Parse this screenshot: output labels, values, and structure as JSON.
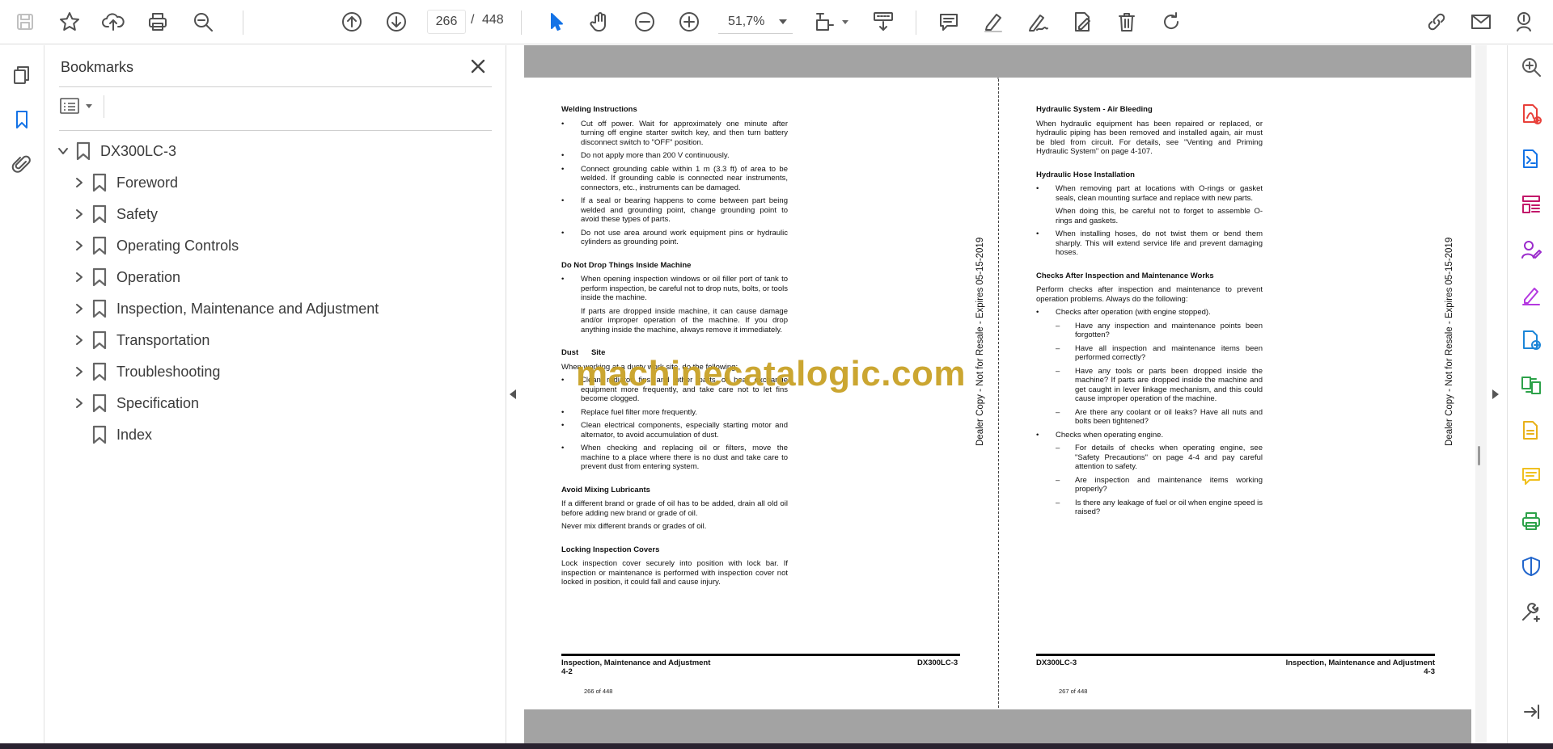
{
  "toolbar": {
    "current_page": "266",
    "page_separator": "/",
    "total_pages": "448",
    "zoom": "51,7%"
  },
  "bookmarks_panel": {
    "title": "Bookmarks",
    "root": "DX300LC-3",
    "items": [
      {
        "label": "Foreword",
        "expandable": true
      },
      {
        "label": "Safety",
        "expandable": true
      },
      {
        "label": "Operating Controls",
        "expandable": true
      },
      {
        "label": "Operation",
        "expandable": true
      },
      {
        "label": "Inspection, Maintenance and Adjustment",
        "expandable": true
      },
      {
        "label": "Transportation",
        "expandable": true
      },
      {
        "label": "Troubleshooting",
        "expandable": true
      },
      {
        "label": "Specification",
        "expandable": true
      },
      {
        "label": "Index",
        "expandable": false
      }
    ]
  },
  "watermark": "machinecatalogic.com",
  "left_page": {
    "side_stamp": "Dealer Copy - Not for Resale - Expires 05-15-2019",
    "welding": {
      "heading": "Welding Instructions",
      "bullets": [
        "Cut off power. Wait for approximately one minute after turning off engine starter switch key, and then turn battery disconnect switch to \"OFF\" position.",
        "Do not apply more than 200 V continuously.",
        "Connect grounding cable within 1 m (3.3 ft) of area to be welded. If grounding cable is connected near instruments, connectors, etc., instruments can be damaged.",
        "If a seal or bearing happens to come between part being welded and grounding point, change grounding point to avoid these types of parts.",
        "Do not use area around work equipment pins or hydraulic cylinders as grounding point."
      ]
    },
    "dropping": {
      "heading": "Do Not Drop Things Inside Machine",
      "bullet": "When opening inspection windows or oil filler port of tank to perform inspection, be careful not to drop nuts, bolts, or tools inside the machine.",
      "sub": "If parts are dropped inside machine, it can cause damage and/or improper operation of the machine. If you drop anything inside the machine, always remove it immediately."
    },
    "dusty": {
      "heading": "Dust      Site",
      "intro": "When working at a dusty work site, do the following:",
      "bullets": [
        "Clean radiator fins and other parts of heat exchange equipment more frequently, and take care not to let fins become clogged.",
        "Replace fuel filter more frequently.",
        "Clean electrical components, especially starting motor and alternator, to avoid accumulation of dust.",
        "When checking and replacing oil or filters, move the machine to a place where there is no dust and take care to prevent dust from entering system."
      ]
    },
    "lubricants": {
      "heading": "Avoid Mixing Lubricants",
      "p1": "If a different brand or grade of oil has to be added, drain all old oil before adding new brand or grade of oil.",
      "p2": "Never mix different brands or grades of oil."
    },
    "covers": {
      "heading": "Locking Inspection Covers",
      "p1": "Lock inspection cover securely into position with lock bar. If inspection or maintenance is performed with inspection cover not locked in position, it could fall and cause injury."
    },
    "footer_left": "Inspection, Maintenance and Adjustment",
    "footer_left_num": "4-2",
    "footer_right": "DX300LC-3",
    "page_counter": "266 of 448"
  },
  "right_page": {
    "side_stamp": "Dealer Copy - Not for Resale - Expires 05-15-2019",
    "bleeding": {
      "heading": "Hydraulic System - Air Bleeding",
      "p1": "When hydraulic equipment has been repaired or replaced, or hydraulic piping has been removed and installed again, air must be bled from circuit. For details, see \"Venting and Priming Hydraulic System\" on page 4-107."
    },
    "hose": {
      "heading": "Hydraulic Hose Installation",
      "b1": "When removing part at locations with O-rings or gasket seals, clean mounting surface and replace with new parts.",
      "b1_sub": "When doing this, be careful not to forget to assemble O-rings and gaskets.",
      "b2": "When installing hoses, do not twist them or bend them sharply. This will extend service life and prevent damaging hoses."
    },
    "checks": {
      "heading": "Checks After Inspection and Maintenance Works",
      "intro": "Perform checks after inspection and maintenance to prevent operation problems. Always do the following:",
      "b1": "Checks after operation (with engine stopped).",
      "b1_dashes": [
        "Have any inspection and maintenance points been forgotten?",
        "Have all inspection and maintenance items been performed correctly?",
        "Have any tools or parts been dropped inside the machine? If parts are dropped inside the machine and get caught in lever linkage mechanism, and this could cause improper operation of the machine.",
        "Are there any coolant or oil leaks? Have all nuts and bolts been tightened?"
      ],
      "b2": "Checks when operating engine.",
      "b2_dashes": [
        "For details of checks when operating engine, see \"Safety Precautions\" on page 4-4 and pay careful attention to safety.",
        "Are inspection and maintenance items working properly?",
        "Is there any leakage of fuel or oil when engine speed is raised?"
      ]
    },
    "footer_left": "DX300LC-3",
    "footer_right": "Inspection, Maintenance and Adjustment",
    "footer_right_num": "4-3",
    "page_counter": "267 of 448"
  },
  "right_rail_colors": [
    "#5a5a5a",
    "#e8403a",
    "#1473e6",
    "#c2166a",
    "#9b2bcc",
    "#b438e0",
    "#1c86d8",
    "#2da24a",
    "#e8b11a",
    "#f0c020",
    "#2da24a",
    "#2266cc",
    "#505050"
  ]
}
